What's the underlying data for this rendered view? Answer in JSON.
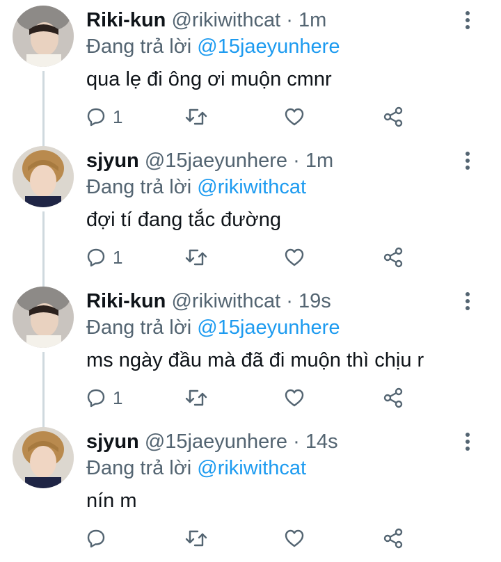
{
  "labels": {
    "reply_prefix": "Đang trả lời",
    "separator": "·"
  },
  "icons": [
    "reply-icon",
    "retweet-icon",
    "like-icon",
    "share-icon",
    "more-vertical-icon"
  ],
  "colors": {
    "mention": "#1d9bf0",
    "muted": "#536471",
    "thread_line": "#cfd9de"
  },
  "tweets": [
    {
      "name": "Riki-kun",
      "handle": "@rikiwithcat",
      "time": "1m",
      "reply_to": "@15jaeyunhere",
      "text": "qua lẹ đi ông ơi muộn cmnr",
      "reply_count": "1"
    },
    {
      "name": "sjyun",
      "handle": "@15jaeyunhere",
      "time": "1m",
      "reply_to": "@rikiwithcat",
      "text": "đợi tí đang tắc đường",
      "reply_count": "1"
    },
    {
      "name": "Riki-kun",
      "handle": "@rikiwithcat",
      "time": "19s",
      "reply_to": "@15jaeyunhere",
      "text": "ms ngày đầu mà đã đi muộn thì chịu r",
      "reply_count": "1"
    },
    {
      "name": "sjyun",
      "handle": "@15jaeyunhere",
      "time": "14s",
      "reply_to": "@rikiwithcat",
      "text": "nín m",
      "reply_count": ""
    }
  ]
}
